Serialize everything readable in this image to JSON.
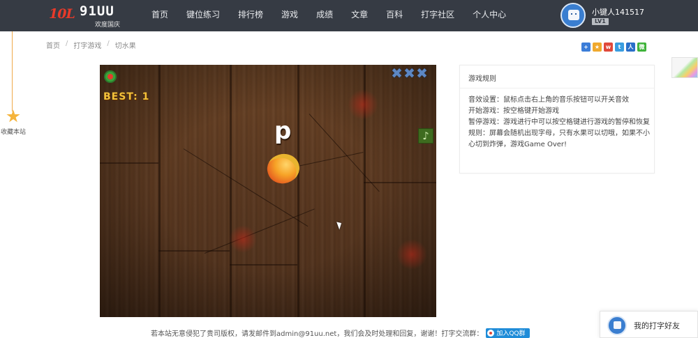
{
  "header": {
    "logo": {
      "mark": "10L",
      "brand": "91UU",
      "subtitle": "欢度国庆"
    },
    "nav": [
      "首页",
      "键位练习",
      "排行榜",
      "游戏",
      "成绩",
      "文章",
      "百科",
      "打字社区",
      "个人中心"
    ],
    "user": {
      "name": "小键人141517",
      "level": "LV1"
    }
  },
  "sidebar": {
    "favorite_label": "收藏本站"
  },
  "breadcrumb": [
    "首页",
    "打字游戏",
    "切水果"
  ],
  "share_icons": [
    {
      "name": "share-plus-icon",
      "glyph": "+",
      "color": "#3b7dd8"
    },
    {
      "name": "share-qzone-icon",
      "glyph": "★",
      "color": "#f0a92e"
    },
    {
      "name": "share-weibo-icon",
      "glyph": "w",
      "color": "#e0483a"
    },
    {
      "name": "share-tencent-icon",
      "glyph": "t",
      "color": "#3a9de0"
    },
    {
      "name": "share-renren-icon",
      "glyph": "人",
      "color": "#2a6fc9"
    },
    {
      "name": "share-wechat-icon",
      "glyph": "微",
      "color": "#3fb33a"
    }
  ],
  "game": {
    "best_label": "BEST:",
    "best_value": "1",
    "current_letter": "p",
    "lives_marks": [
      "✖",
      "✖",
      "✖"
    ],
    "music_glyph": "♪"
  },
  "rules": {
    "title": "游戏规则",
    "lines": [
      "音效设置：鼠标点击右上角的音乐按钮可以开关音效",
      "开始游戏：按空格键开始游戏",
      "暂停游戏：游戏进行中可以按空格键进行游戏的暂停和恢复",
      "规则：屏幕会随机出现字母，只有水果可以切哦，如果不小心切到炸弹，游戏Game Over!"
    ]
  },
  "footer": {
    "text": "若本站无意侵犯了贵司版权，请发邮件到admin@91uu.net，我们会及时处理和回复，谢谢！打字交流群：",
    "qq_button": "加入QQ群"
  },
  "friends_widget": {
    "label": "我的打字好友"
  }
}
